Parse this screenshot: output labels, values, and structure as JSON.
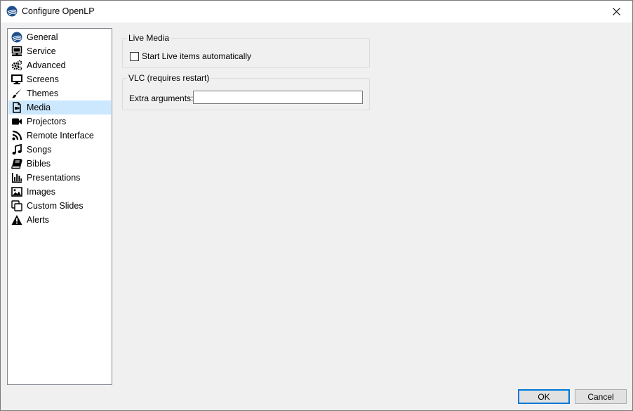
{
  "window": {
    "title": "Configure OpenLP"
  },
  "sidebar": {
    "items": [
      {
        "label": "General",
        "icon": "openlp-logo-icon"
      },
      {
        "label": "Service",
        "icon": "service-icon"
      },
      {
        "label": "Advanced",
        "icon": "cogs-icon"
      },
      {
        "label": "Screens",
        "icon": "monitor-icon"
      },
      {
        "label": "Themes",
        "icon": "paintbrush-icon"
      },
      {
        "label": "Media",
        "icon": "media-file-icon",
        "selected": true
      },
      {
        "label": "Projectors",
        "icon": "video-camera-icon"
      },
      {
        "label": "Remote Interface",
        "icon": "rss-icon"
      },
      {
        "label": "Songs",
        "icon": "music-note-icon"
      },
      {
        "label": "Bibles",
        "icon": "book-icon"
      },
      {
        "label": "Presentations",
        "icon": "bar-chart-icon"
      },
      {
        "label": "Images",
        "icon": "image-icon"
      },
      {
        "label": "Custom Slides",
        "icon": "copy-icon"
      },
      {
        "label": "Alerts",
        "icon": "warning-icon"
      }
    ]
  },
  "media": {
    "live_media": {
      "title": "Live Media",
      "start_live_label": "Start Live items automatically",
      "start_live_checked": false
    },
    "vlc": {
      "title": "VLC (requires restart)",
      "extra_args_label": "Extra arguments:",
      "extra_args_value": ""
    }
  },
  "buttons": {
    "ok": "OK",
    "cancel": "Cancel"
  },
  "colors": {
    "selection": "#cce8ff",
    "dialog_bg": "#f0f0f0",
    "accent": "#0078d7"
  }
}
